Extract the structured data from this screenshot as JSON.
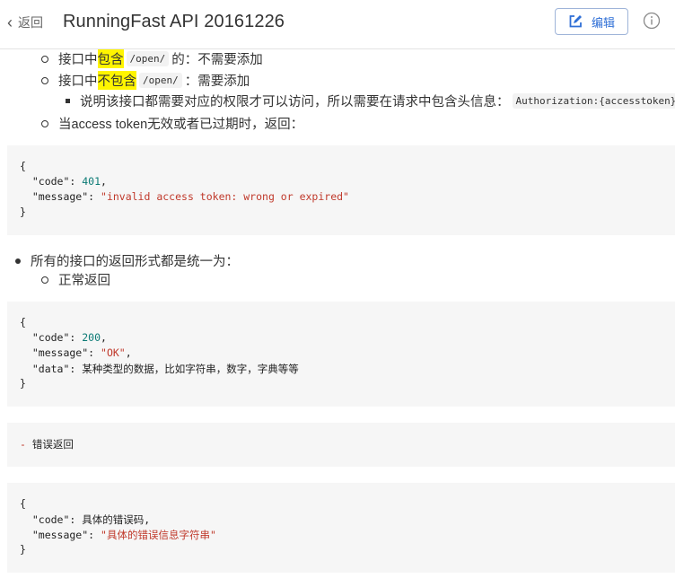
{
  "header": {
    "back_label": "返回",
    "title": "RunningFast API 20161226",
    "edit_label": "编辑"
  },
  "list1": {
    "item1": {
      "prefix": "接口中",
      "highlight": "包含",
      "code": "/open/",
      "suffix": "的：不需要添加"
    },
    "item2": {
      "prefix": "接口中",
      "highlight": "不包含",
      "code": "/open/",
      "suffix": "：需要添加"
    },
    "item2_sub": {
      "text": "说明该接口都需要对应的权限才可以访问，所以需要在请求中包含头信息：",
      "code": "Authorization:{accesstoken}"
    },
    "item3": "当access token无效或者已过期时，返回："
  },
  "code1": {
    "open": "{",
    "l1_key": "  \"code\": ",
    "l1_val": "401",
    "l1_end": ",",
    "l2_key": "  \"message\": ",
    "l2_val": "\"invalid access token: wrong or expired\"",
    "close": "}"
  },
  "list2": {
    "item": "所有的接口的返回形式都是统一为：",
    "sub": "正常返回"
  },
  "code2": {
    "open": "{",
    "l1_key": "  \"code\": ",
    "l1_val": "200",
    "l1_end": ",",
    "l2_key": "  \"message\": ",
    "l2_val": "\"OK\"",
    "l2_end": ",",
    "l3": "  \"data\": 某种类型的数据，比如字符串，数字，字典等等",
    "close": "}"
  },
  "code3": {
    "dash": "-",
    "text": " 错误返回"
  },
  "code4": {
    "open": "{",
    "l1": "  \"code\": 具体的错误码,",
    "l2_key": "  \"message\": ",
    "l2_val": "\"具体的错误信息字符串\"",
    "close": "}"
  },
  "colors": {
    "accent": "#2f6fd6",
    "highlight": "#fff500",
    "code_bg": "#f6f6f6",
    "number": "#0b7a75",
    "string": "#c0392b"
  },
  "icons": [
    "chevron-left-icon",
    "edit-icon",
    "info-icon"
  ]
}
